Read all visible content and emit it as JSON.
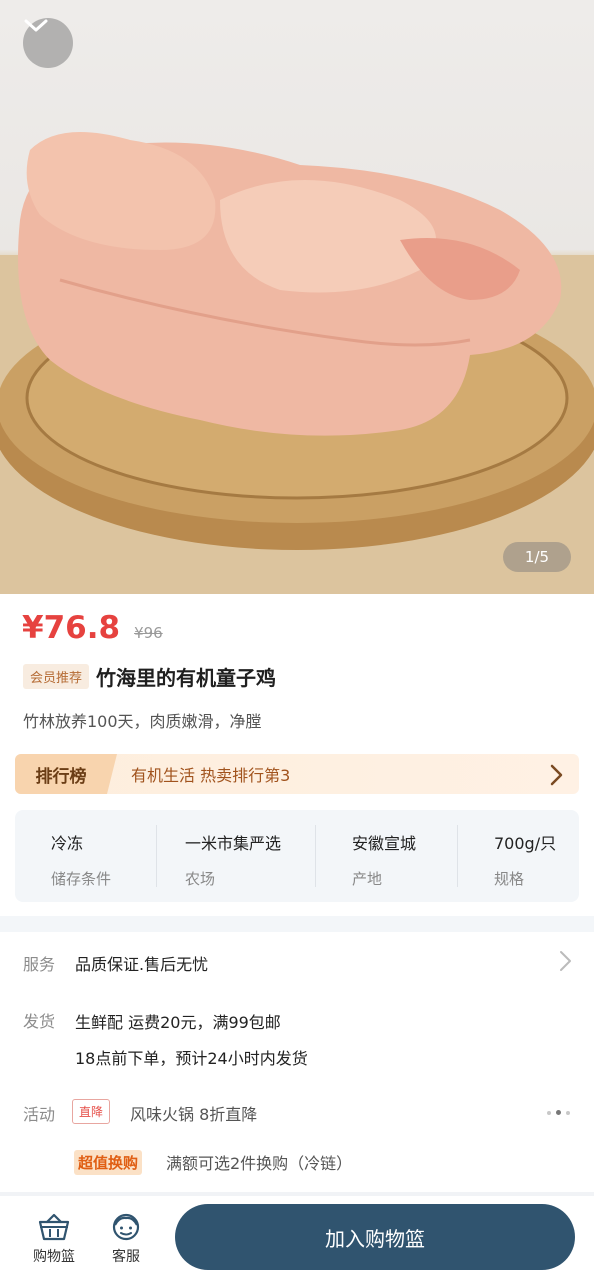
{
  "hero": {
    "image_alt": "organic young chicken on wooden cutting board",
    "pager": "1/5",
    "collapse_icon": "chevron-down-icon"
  },
  "product": {
    "price": "¥76.8",
    "original_price": "¥96",
    "member_tag": "会员推荐",
    "title": "竹海里的有机童子鸡",
    "subtitle": "竹林放养100天，肉质嫩滑，净膛"
  },
  "ranking": {
    "badge": "排行榜",
    "text": "有机生活 热卖排行第3"
  },
  "specs": [
    {
      "value": "冷冻",
      "label": "储存条件"
    },
    {
      "value": "一米市集严选",
      "label": "农场"
    },
    {
      "value": "安徽宣城",
      "label": "产地"
    },
    {
      "value": "700g/只",
      "label": "规格"
    }
  ],
  "service": {
    "label": "服务",
    "text": "品质保证.售后无忧"
  },
  "shipping": {
    "label": "发货",
    "line1": "生鲜配 运费20元，满99包邮",
    "line2": "18点前下单，预计24小时内发货"
  },
  "activity": {
    "label": "活动",
    "tag1": "直降",
    "text1": "风味火锅 8折直降",
    "tag2": "超值换购",
    "text2": "满额可选2件换购（冷链）"
  },
  "bottom_bar": {
    "basket_label": "购物篮",
    "service_label": "客服",
    "add_button": "加入购物篮"
  },
  "colors": {
    "price": "#e6423f",
    "primary_button": "#30546f",
    "rank_bg": "#fdeedd"
  }
}
